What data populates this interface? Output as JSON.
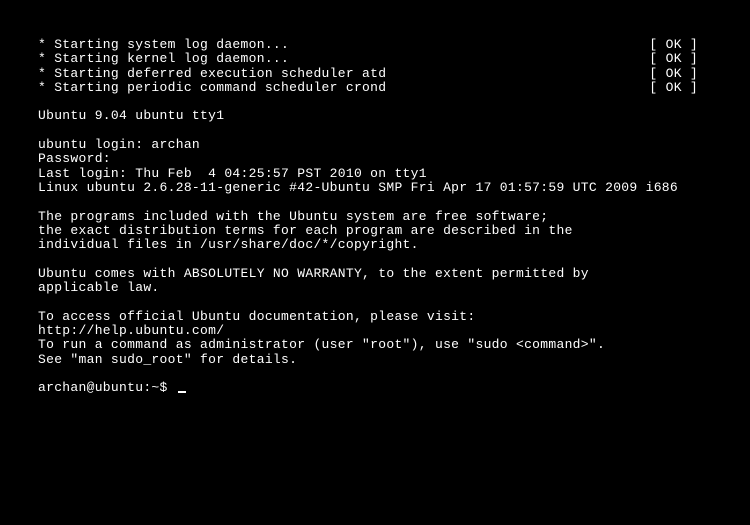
{
  "boot_services": [
    {
      "text": " * Starting system log daemon...",
      "status": "[ OK ]"
    },
    {
      "text": " * Starting kernel log daemon...",
      "status": "[ OK ]"
    },
    {
      "text": " * Starting deferred execution scheduler atd",
      "status": "[ OK ]"
    },
    {
      "text": " * Starting periodic command scheduler crond",
      "status": "[ OK ]"
    }
  ],
  "banner": "Ubuntu 9.04 ubuntu tty1",
  "login_prompt": "ubuntu login: ",
  "login_user": "archan",
  "password_prompt": "Password:",
  "last_login": "Last login: Thu Feb  4 04:25:57 PST 2010 on tty1",
  "kernel_line": "Linux ubuntu 2.6.28-11-generic #42-Ubuntu SMP Fri Apr 17 01:57:59 UTC 2009 i686",
  "motd": [
    "The programs included with the Ubuntu system are free software;",
    "the exact distribution terms for each program are described in the",
    "individual files in /usr/share/doc/*/copyright."
  ],
  "warranty": [
    "Ubuntu comes with ABSOLUTELY NO WARRANTY, to the extent permitted by",
    "applicable law."
  ],
  "docs": [
    "To access official Ubuntu documentation, please visit:",
    "http://help.ubuntu.com/"
  ],
  "sudo": [
    "To run a command as administrator (user \"root\"), use \"sudo <command>\".",
    "See \"man sudo_root\" for details."
  ],
  "prompt": "archan@ubuntu:~$ "
}
